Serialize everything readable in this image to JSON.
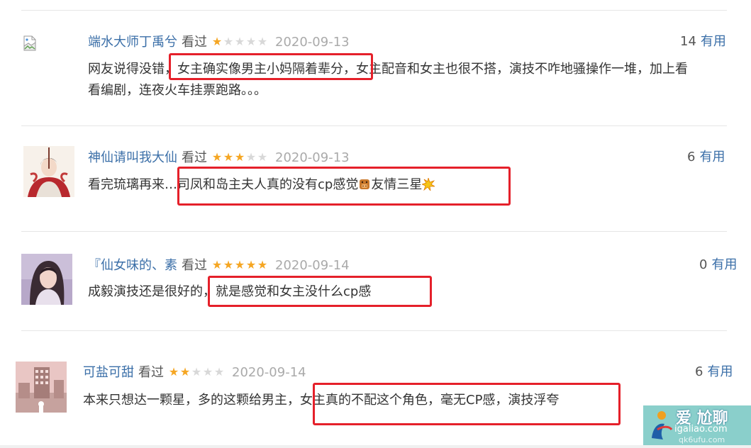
{
  "comments": [
    {
      "author": "端水大师丁禹兮",
      "watched": "看过",
      "rating": 1,
      "date": "2020-09-13",
      "useful_count": "14",
      "useful_label": "有用",
      "text_lines": [
        "网友说得没错，女主确实像男主小妈隔着辈分，女主配音和女主也很不搭，演技不咋地骚操作一堆，加上看",
        "看编剧，连夜火车挂票跑路。。。"
      ],
      "avatar": "broken-image-icon"
    },
    {
      "author": "神仙请叫我大仙",
      "watched": "看过",
      "rating": 3,
      "date": "2020-09-13",
      "useful_count": "6",
      "useful_label": "有用",
      "text_before": "看完琉璃再来…司凤和岛主夫人真的没有cp感觉",
      "emoji1": "pig-face-emoji-icon",
      "text_middle": "友情三星",
      "emoji2": "collision-emoji-icon",
      "avatar": "illustrated-portrait-avatar"
    },
    {
      "author": "『仙女味的、素",
      "watched": "看过",
      "rating": 5,
      "date": "2020-09-14",
      "useful_count": "0",
      "useful_label": "有用",
      "text": "成毅演技还是很好的，就是感觉和女主没什么cp感",
      "avatar": "photo-portrait-avatar"
    },
    {
      "author": "可盐可甜",
      "watched": "看过",
      "rating": 2,
      "date": "2020-09-14",
      "useful_count": "6",
      "useful_label": "有用",
      "text": "本来只想达一颗星，多的这颗给男主，女主真的不配这个角色，毫无CP感，演技浮夸",
      "avatar": "city-photo-avatar"
    }
  ],
  "watermark": {
    "brand": "爱 尬聊",
    "url": "igaliao.com",
    "sub": "qk6ufu.com",
    "icon": "person-logo-icon"
  },
  "colors": {
    "author": "#3b6fa8",
    "star_on": "#f5a623",
    "star_off": "#d8d8d8",
    "highlight": "#e5202a",
    "date": "#aaaaaa"
  }
}
